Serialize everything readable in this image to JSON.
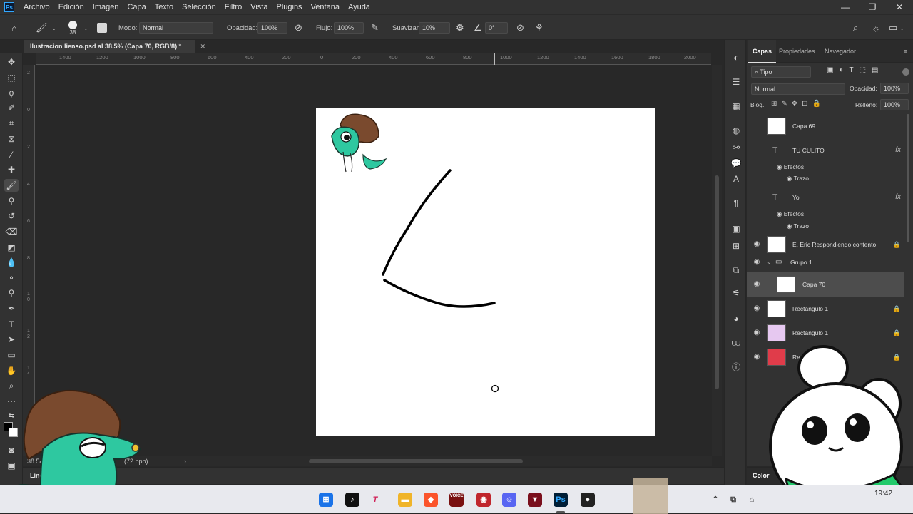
{
  "app": {
    "logo_text": "Ps"
  },
  "menu": [
    "Archivo",
    "Edición",
    "Imagen",
    "Capa",
    "Texto",
    "Selección",
    "Filtro",
    "Vista",
    "Plugins",
    "Ventana",
    "Ayuda"
  ],
  "window_controls": {
    "minimize": "—",
    "restore": "❐",
    "close": "✕"
  },
  "options": {
    "brush_size": "38",
    "mode_label": "Modo:",
    "mode_value": "Normal",
    "opacity_label": "Opacidad:",
    "opacity_value": "100%",
    "flow_label": "Flujo:",
    "flow_value": "100%",
    "smoothing_label": "Suavizar:",
    "smoothing_value": "10%",
    "angle_value": "0°"
  },
  "document": {
    "tab_title": "Ilustracion lienso.psd al 38.5% (Capa 70, RGB/8) *",
    "close": "✕"
  },
  "ruler_h_ticks": [
    "1400",
    "1200",
    "1000",
    "800",
    "600",
    "400",
    "200",
    "0",
    "200",
    "400",
    "600",
    "800",
    "1000",
    "1200",
    "1400",
    "1600",
    "1800",
    "2000"
  ],
  "ruler_v_ticks": [
    "2",
    "0",
    "2",
    "4",
    "6",
    "8",
    "1",
    "0",
    "1",
    "2",
    "1",
    "4",
    "1",
    "6",
    "1",
    "8",
    "2",
    "0",
    "2",
    "2"
  ],
  "status": {
    "zoom": "38.54 %",
    "info": "(72 ppp)"
  },
  "timeline_label": "Línea d",
  "panels": {
    "tabs": [
      "Capas",
      "Propiedades",
      "Navegador"
    ],
    "filter_kind": "Tipo",
    "blend_mode": "Normal",
    "opacity_label": "Opacidad:",
    "opacity_value": "100%",
    "lock_label": "Bloq.:",
    "fill_label": "Relleno:",
    "fill_value": "100%",
    "color_tab": "Color"
  },
  "layers": [
    {
      "name": "Capa 69",
      "visible": false,
      "kind": "pixel"
    },
    {
      "name": "TU CULITO",
      "visible": false,
      "kind": "text",
      "fx": "fx",
      "effects_label": "Efectos",
      "effect": "Trazo"
    },
    {
      "name": "Yo",
      "visible": false,
      "kind": "text",
      "fx": "fx",
      "effects_label": "Efectos",
      "effect": "Trazo"
    },
    {
      "name": "E. Eric Respondiendo contento",
      "visible": true,
      "kind": "smart",
      "locked": true
    },
    {
      "name": "Grupo 1",
      "visible": true,
      "kind": "group"
    },
    {
      "name": "Capa 70",
      "visible": true,
      "kind": "pixel",
      "selected": true
    },
    {
      "name": "Rectángulo 1",
      "visible": true,
      "kind": "shape",
      "color": "#ffffff",
      "locked": true
    },
    {
      "name": "Rectángulo 1",
      "visible": true,
      "kind": "shape",
      "color": "#e6c8f0",
      "locked": true
    },
    {
      "name": "Re",
      "visible": true,
      "kind": "shape",
      "color": "#e03c4a",
      "locked": true
    }
  ],
  "taskbar": {
    "clock": "19:42"
  }
}
